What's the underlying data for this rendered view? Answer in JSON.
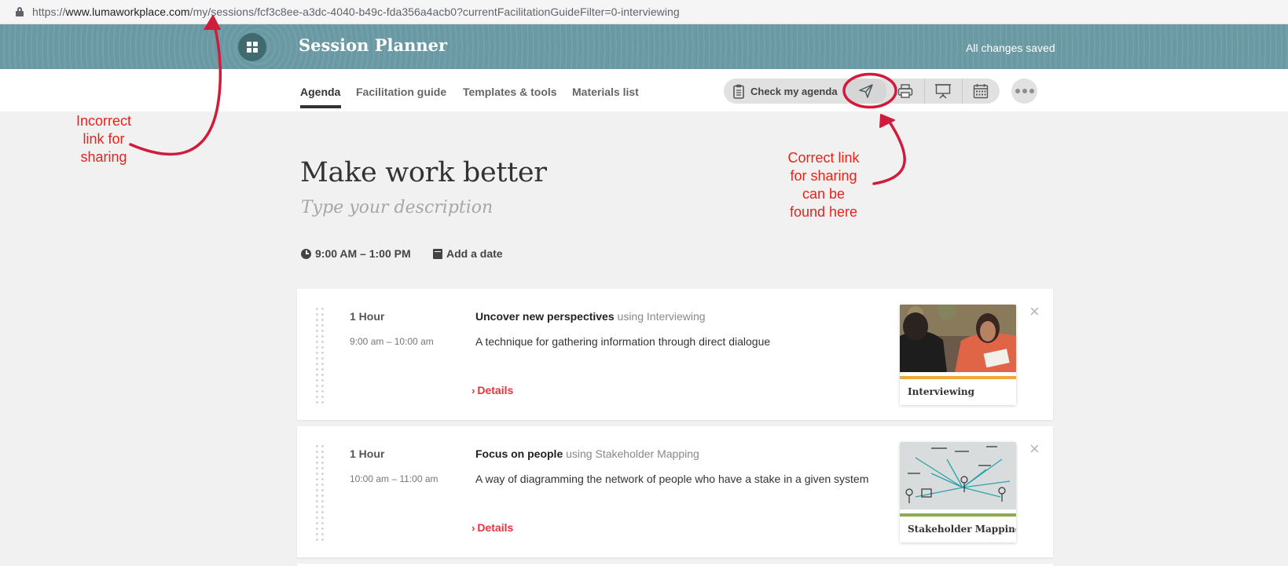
{
  "browser": {
    "url_scheme": "https://",
    "url_host": "www.lumaworkplace.com",
    "url_path": "/my/sessions/fcf3c8ee-a3dc-4040-b49c-fda356a4acb0?currentFacilitationGuideFilter=0-interviewing"
  },
  "header": {
    "title": "Session Planner",
    "save_status": "All changes saved"
  },
  "tabs": [
    {
      "label": "Agenda",
      "active": true
    },
    {
      "label": "Facilitation guide",
      "active": false
    },
    {
      "label": "Templates & tools",
      "active": false
    },
    {
      "label": "Materials list",
      "active": false
    }
  ],
  "toolbar": {
    "check_label": "Check my agenda",
    "icons": [
      "clipboard-icon",
      "send-icon",
      "print-icon",
      "presentation-icon",
      "calendar-icon",
      "more-icon"
    ]
  },
  "annotations": {
    "incorrect": [
      "Incorrect",
      "link for",
      "sharing"
    ],
    "correct": [
      "Correct link",
      "for sharing",
      "can be",
      "found here"
    ],
    "color": "#e8231a"
  },
  "session": {
    "title": "Make work better",
    "description_placeholder": "Type your description",
    "time": "9:00 AM – 1:00 PM",
    "date_action": "Add a date"
  },
  "agenda_items": [
    {
      "duration": "1 Hour",
      "time": "9:00 am – 10:00 am",
      "title": "Uncover new perspectives",
      "using": "using Interviewing",
      "description": "A technique for gathering information through direct dialogue",
      "details_label": "Details",
      "thumb_caption": "Interviewing",
      "stripe_color": "#f0a83a"
    },
    {
      "duration": "1 Hour",
      "time": "10:00 am – 11:00 am",
      "title": "Focus on people",
      "using": "using Stakeholder Mapping",
      "description": "A way of diagramming the network of people who have a stake in a given system",
      "details_label": "Details",
      "thumb_caption": "Stakeholder Mapping",
      "stripe_color": "#8cab52"
    }
  ]
}
